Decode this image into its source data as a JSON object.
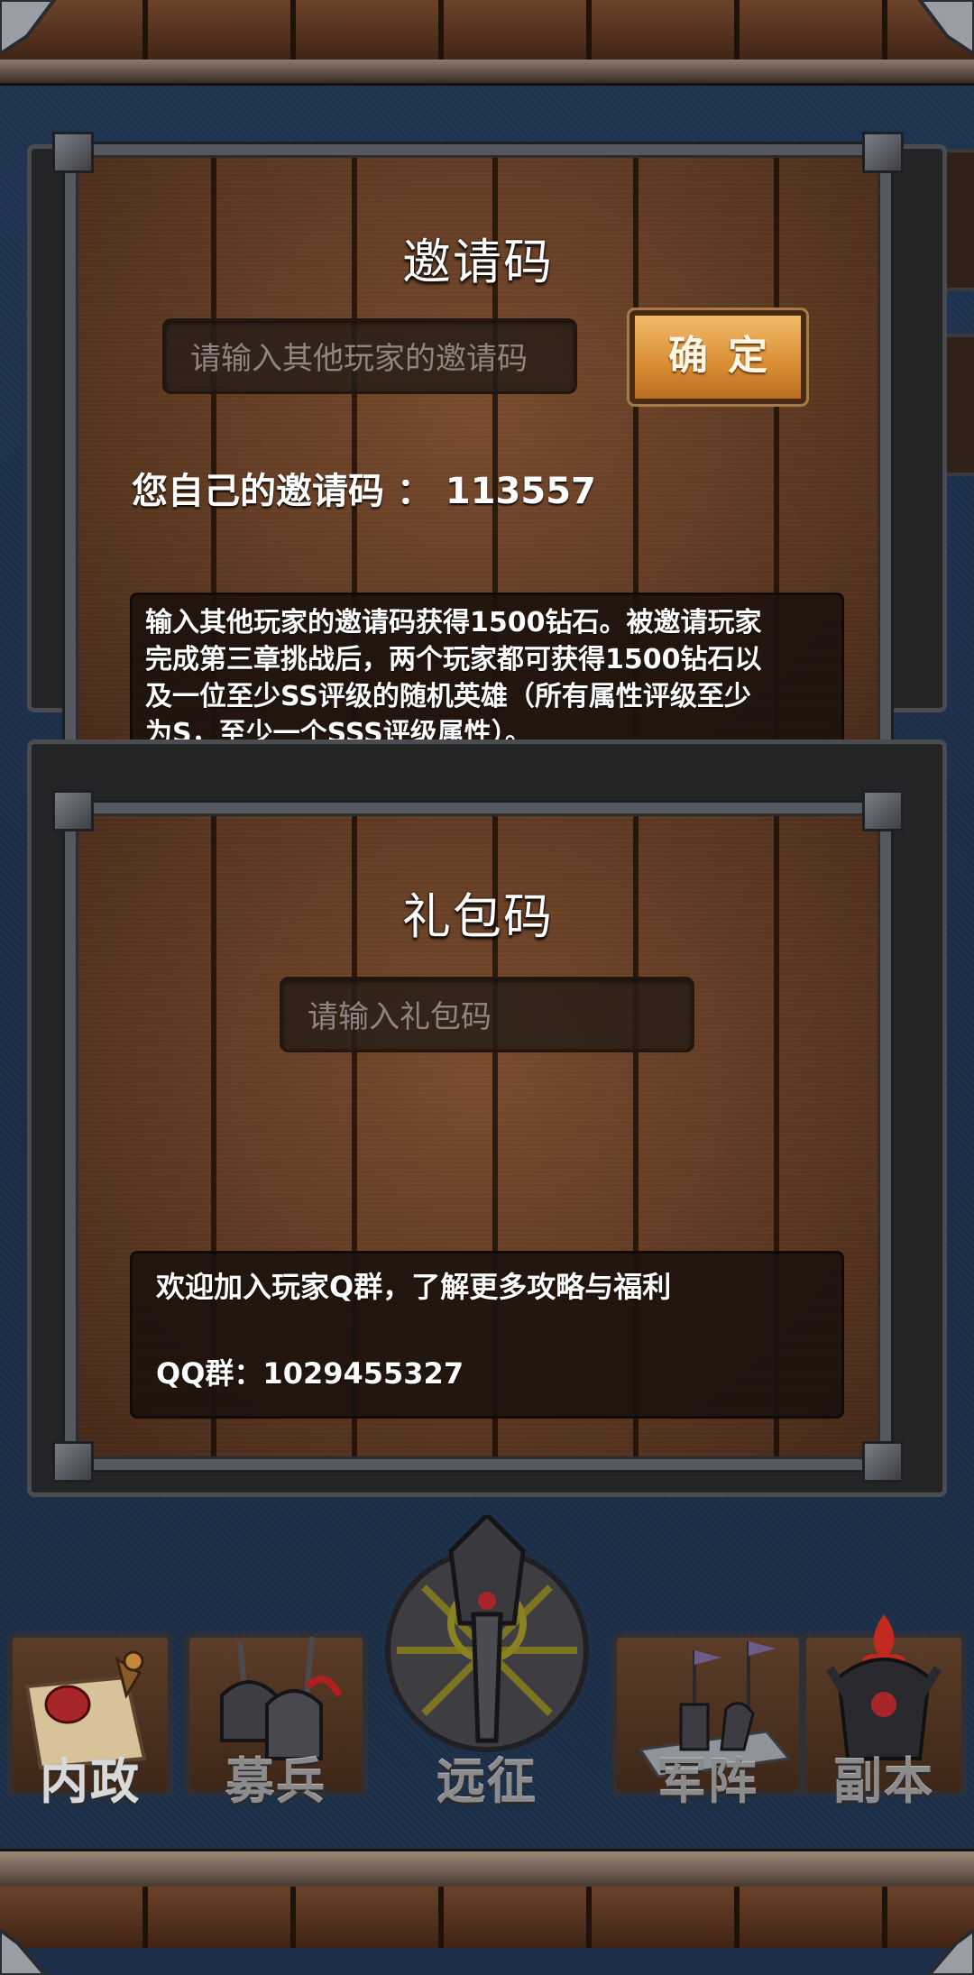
{
  "invite": {
    "title": "邀请码",
    "input_placeholder": "请输入其他玩家的邀请码",
    "confirm_label": "确定",
    "own_code_label": "您自己的邀请码 ：",
    "own_code": "113557",
    "description_lines": [
      "输入其他玩家的邀请码获得1500钻石。被邀请玩家",
      "完成第三章挑战后，两个玩家都可获得1500钻石以",
      "及一位至少SS评级的随机英雄（所有属性评级至少",
      "为S，至少一个SSS评级属性）。"
    ]
  },
  "gift": {
    "title": "礼包码",
    "input_placeholder": "请输入礼包码",
    "info_line1": "欢迎加入玩家Q群，了解更多攻略与福利",
    "qq_label": "QQ群：",
    "qq_number": "1029455327"
  },
  "nav": {
    "items": [
      {
        "label": "内政",
        "icon": "scroll-icon"
      },
      {
        "label": "募兵",
        "icon": "helmets-icon"
      },
      {
        "label": "远征",
        "icon": "sword-emblem-icon"
      },
      {
        "label": "军阵",
        "icon": "chess-icon"
      },
      {
        "label": "副本",
        "icon": "dark-helmet-icon"
      }
    ]
  },
  "colors": {
    "background": "#1c2e48",
    "wood": "#5f3a22",
    "button": "#d98d33",
    "frame": "#55585f"
  }
}
